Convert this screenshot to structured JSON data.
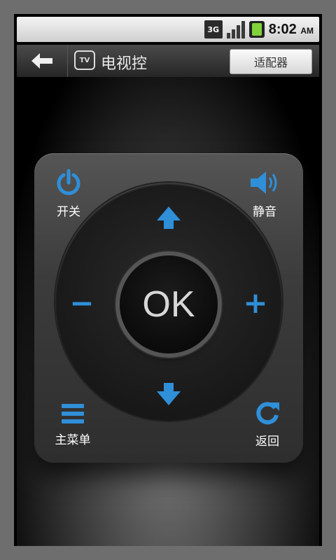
{
  "status_bar": {
    "network": "3G",
    "time": "8:02",
    "ampm": "AM"
  },
  "title_bar": {
    "tv_badge": "TV",
    "title": "电视控",
    "adapter_button": "适配器"
  },
  "remote": {
    "power_label": "开关",
    "mute_label": "静音",
    "menu_label": "主菜单",
    "return_label": "返回",
    "ok_label": "OK",
    "minus_symbol": "−",
    "plus_symbol": "+"
  },
  "colors": {
    "accent_blue": "#2f8fd8"
  }
}
